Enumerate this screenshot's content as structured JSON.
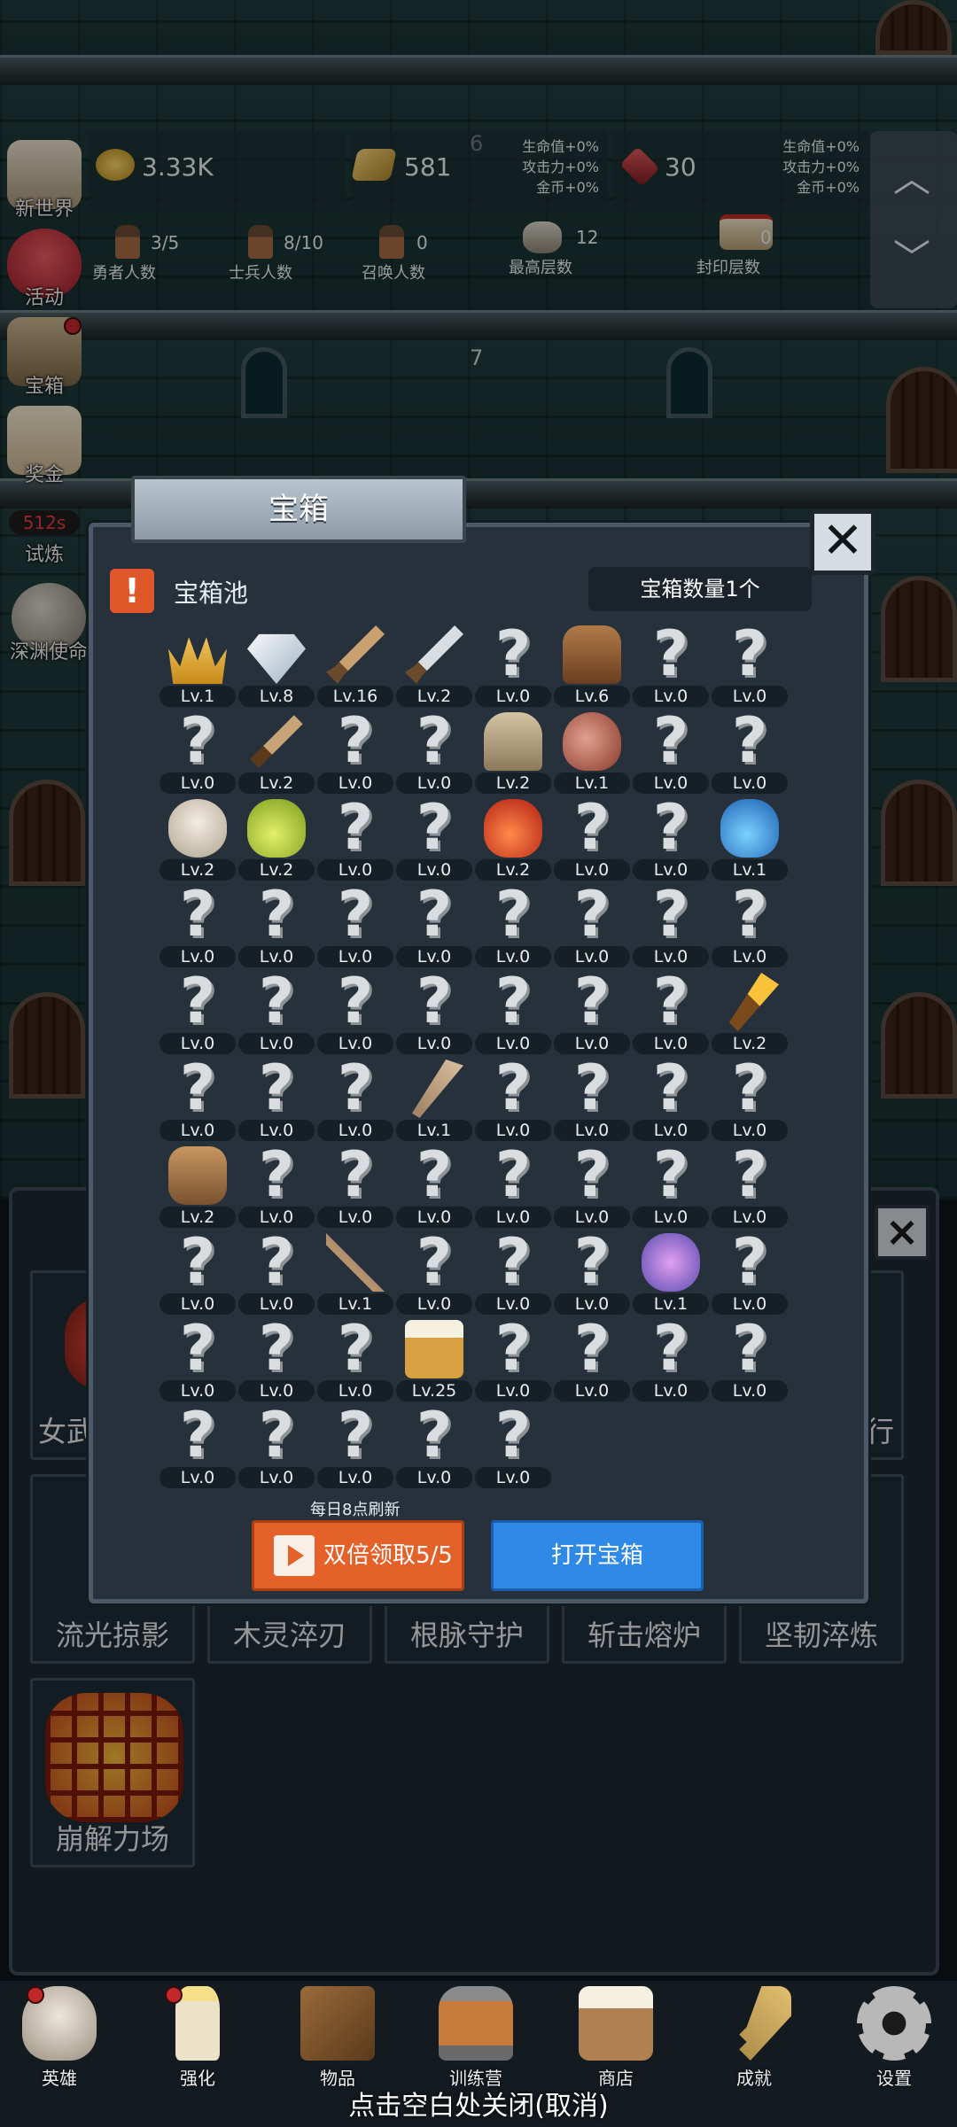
{
  "hud": {
    "gold": "3.33K",
    "bars": "581",
    "floor_a": "6",
    "bonus_a": [
      "生命值+0%",
      "攻击力+0%",
      "金币+0%"
    ],
    "gem": "30",
    "bonus_b": [
      "生命值+0%",
      "攻击力+0%",
      "金币+0%"
    ],
    "heroes": "3/5",
    "heroes_label": "勇者人数",
    "soldiers": "8/10",
    "soldiers_label": "士兵人数",
    "summons": "0",
    "summons_label": "召唤人数",
    "max_floor": "12",
    "max_floor_label": "最高层数",
    "seal": "0",
    "seal_label": "封印层数",
    "floor_b": "7",
    "scroll_up": "︿",
    "scroll_down": "﹀"
  },
  "side_menu": [
    {
      "label": "新世界",
      "icon": "map-icon"
    },
    {
      "label": "活动",
      "icon": "heart-icon"
    },
    {
      "label": "宝箱",
      "icon": "chest-icon"
    },
    {
      "label": "奖金",
      "icon": "envelope-icon"
    },
    {
      "label": "试炼",
      "icon": "trial-icon",
      "timer": "512s"
    },
    {
      "label": "深渊使命",
      "icon": "orb-icon"
    }
  ],
  "skills": [
    "女武",
    "流光掠影",
    "木灵淬刃",
    "根脉守护",
    "斩击熔炉",
    "坚韧淬炼",
    "崩解力场",
    "行"
  ],
  "dialog": {
    "title": "宝箱",
    "close": "✕",
    "alert": "!",
    "pool_title": "宝箱池",
    "count": "宝箱数量1个",
    "refresh_note": "每日8点刷新",
    "double_btn": "双倍领取5/5",
    "open_btn": "打开宝箱",
    "items": [
      {
        "lv": "Lv.1",
        "icon": "crown-icon"
      },
      {
        "lv": "Lv.8",
        "icon": "diamond-icon"
      },
      {
        "lv": "Lv.16",
        "icon": "sword-icon"
      },
      {
        "lv": "Lv.2",
        "icon": "steel-sword-icon"
      },
      {
        "lv": "Lv.0",
        "icon": "unknown-icon"
      },
      {
        "lv": "Lv.6",
        "icon": "armor-icon"
      },
      {
        "lv": "Lv.0",
        "icon": "unknown-icon"
      },
      {
        "lv": "Lv.0",
        "icon": "unknown-icon"
      },
      {
        "lv": "Lv.0",
        "icon": "unknown-icon"
      },
      {
        "lv": "Lv.2",
        "icon": "dagger-icon"
      },
      {
        "lv": "Lv.0",
        "icon": "unknown-icon"
      },
      {
        "lv": "Lv.0",
        "icon": "unknown-icon"
      },
      {
        "lv": "Lv.2",
        "icon": "helmet-icon"
      },
      {
        "lv": "Lv.1",
        "icon": "meat-icon"
      },
      {
        "lv": "Lv.0",
        "icon": "unknown-icon"
      },
      {
        "lv": "Lv.0",
        "icon": "unknown-icon"
      },
      {
        "lv": "Lv.2",
        "icon": "bread-icon"
      },
      {
        "lv": "Lv.2",
        "icon": "green-potion-icon"
      },
      {
        "lv": "Lv.0",
        "icon": "unknown-icon"
      },
      {
        "lv": "Lv.0",
        "icon": "unknown-icon"
      },
      {
        "lv": "Lv.2",
        "icon": "red-potion-icon"
      },
      {
        "lv": "Lv.0",
        "icon": "unknown-icon"
      },
      {
        "lv": "Lv.0",
        "icon": "unknown-icon"
      },
      {
        "lv": "Lv.1",
        "icon": "blue-potion-icon"
      },
      {
        "lv": "Lv.0",
        "icon": "unknown-icon"
      },
      {
        "lv": "Lv.0",
        "icon": "unknown-icon"
      },
      {
        "lv": "Lv.0",
        "icon": "unknown-icon"
      },
      {
        "lv": "Lv.0",
        "icon": "unknown-icon"
      },
      {
        "lv": "Lv.0",
        "icon": "unknown-icon"
      },
      {
        "lv": "Lv.0",
        "icon": "unknown-icon"
      },
      {
        "lv": "Lv.0",
        "icon": "unknown-icon"
      },
      {
        "lv": "Lv.0",
        "icon": "unknown-icon"
      },
      {
        "lv": "Lv.0",
        "icon": "unknown-icon"
      },
      {
        "lv": "Lv.0",
        "icon": "unknown-icon"
      },
      {
        "lv": "Lv.0",
        "icon": "unknown-icon"
      },
      {
        "lv": "Lv.0",
        "icon": "unknown-icon"
      },
      {
        "lv": "Lv.0",
        "icon": "unknown-icon"
      },
      {
        "lv": "Lv.0",
        "icon": "unknown-icon"
      },
      {
        "lv": "Lv.0",
        "icon": "unknown-icon"
      },
      {
        "lv": "Lv.2",
        "icon": "torch-icon"
      },
      {
        "lv": "Lv.0",
        "icon": "unknown-icon"
      },
      {
        "lv": "Lv.0",
        "icon": "unknown-icon"
      },
      {
        "lv": "Lv.0",
        "icon": "unknown-icon"
      },
      {
        "lv": "Lv.1",
        "icon": "staff-icon"
      },
      {
        "lv": "Lv.0",
        "icon": "unknown-icon"
      },
      {
        "lv": "Lv.0",
        "icon": "unknown-icon"
      },
      {
        "lv": "Lv.0",
        "icon": "unknown-icon"
      },
      {
        "lv": "Lv.0",
        "icon": "unknown-icon"
      },
      {
        "lv": "Lv.2",
        "icon": "backpack-icon"
      },
      {
        "lv": "Lv.0",
        "icon": "unknown-icon"
      },
      {
        "lv": "Lv.0",
        "icon": "unknown-icon"
      },
      {
        "lv": "Lv.0",
        "icon": "unknown-icon"
      },
      {
        "lv": "Lv.0",
        "icon": "unknown-icon"
      },
      {
        "lv": "Lv.0",
        "icon": "unknown-icon"
      },
      {
        "lv": "Lv.0",
        "icon": "unknown-icon"
      },
      {
        "lv": "Lv.0",
        "icon": "unknown-icon"
      },
      {
        "lv": "Lv.0",
        "icon": "unknown-icon"
      },
      {
        "lv": "Lv.0",
        "icon": "unknown-icon"
      },
      {
        "lv": "Lv.1",
        "icon": "bow-icon"
      },
      {
        "lv": "Lv.0",
        "icon": "unknown-icon"
      },
      {
        "lv": "Lv.0",
        "icon": "unknown-icon"
      },
      {
        "lv": "Lv.0",
        "icon": "unknown-icon"
      },
      {
        "lv": "Lv.1",
        "icon": "tentacle-icon"
      },
      {
        "lv": "Lv.0",
        "icon": "unknown-icon"
      },
      {
        "lv": "Lv.0",
        "icon": "unknown-icon"
      },
      {
        "lv": "Lv.0",
        "icon": "unknown-icon"
      },
      {
        "lv": "Lv.0",
        "icon": "unknown-icon"
      },
      {
        "lv": "Lv.25",
        "icon": "beer-icon"
      },
      {
        "lv": "Lv.0",
        "icon": "unknown-icon"
      },
      {
        "lv": "Lv.0",
        "icon": "unknown-icon"
      },
      {
        "lv": "Lv.0",
        "icon": "unknown-icon"
      },
      {
        "lv": "Lv.0",
        "icon": "unknown-icon"
      },
      {
        "lv": "Lv.0",
        "icon": "unknown-icon"
      },
      {
        "lv": "Lv.0",
        "icon": "unknown-icon"
      },
      {
        "lv": "Lv.0",
        "icon": "unknown-icon"
      },
      {
        "lv": "Lv.0",
        "icon": "unknown-icon"
      },
      {
        "lv": "Lv.0",
        "icon": "unknown-icon"
      }
    ]
  },
  "bottom_nav": [
    {
      "label": "英雄",
      "icon": "skull-icon",
      "dot": true
    },
    {
      "label": "强化",
      "icon": "candle-icon",
      "dot": true
    },
    {
      "label": "物品",
      "icon": "book-icon",
      "dot": false
    },
    {
      "label": "训练营",
      "icon": "lantern-icon",
      "dot": false
    },
    {
      "label": "商店",
      "icon": "mug-icon",
      "dot": false
    },
    {
      "label": "成就",
      "icon": "key-icon",
      "dot": false
    },
    {
      "label": "设置",
      "icon": "gear-icon",
      "dot": false
    }
  ],
  "close_hint": "点击空白处关闭(取消)",
  "colors": {
    "accent_orange": "#e4622a",
    "accent_blue": "#2e8ae6",
    "panel": "#26313c"
  }
}
